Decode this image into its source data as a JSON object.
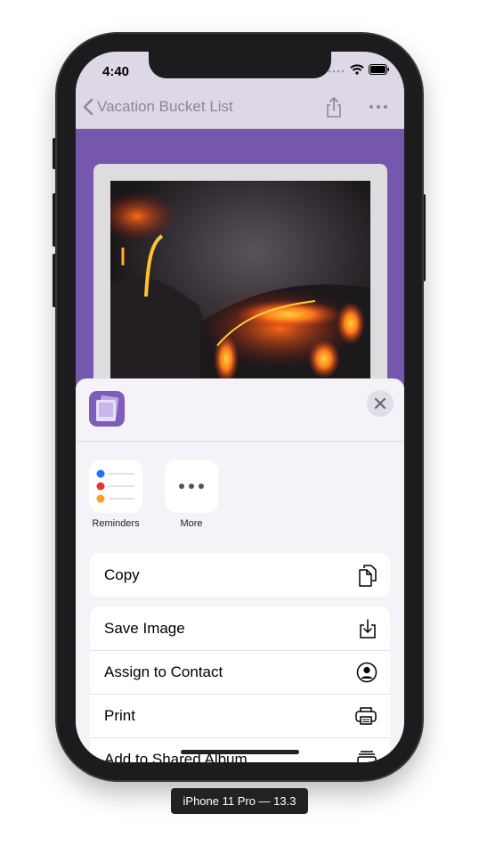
{
  "status_bar": {
    "time": "4:40"
  },
  "navbar": {
    "back_label": "Vacation Bucket List"
  },
  "share_sheet": {
    "app_suggestions": [
      {
        "label": "Reminders",
        "icon": "reminders-icon"
      },
      {
        "label": "More",
        "icon": "more-icon"
      }
    ],
    "copy_action": {
      "label": "Copy",
      "icon": "copy-icon"
    },
    "actions": [
      {
        "label": "Save Image",
        "icon": "save-image-icon"
      },
      {
        "label": "Assign to Contact",
        "icon": "contact-icon"
      },
      {
        "label": "Print",
        "icon": "printer-icon"
      },
      {
        "label": "Add to Shared Album",
        "icon": "shared-album-icon"
      }
    ]
  },
  "simulator_label": "iPhone 11 Pro — 13.3",
  "colors": {
    "accent_purple": "#7557ad",
    "sheet_background": "#f5f2f8",
    "navbar_background": "#ddd7e6"
  }
}
